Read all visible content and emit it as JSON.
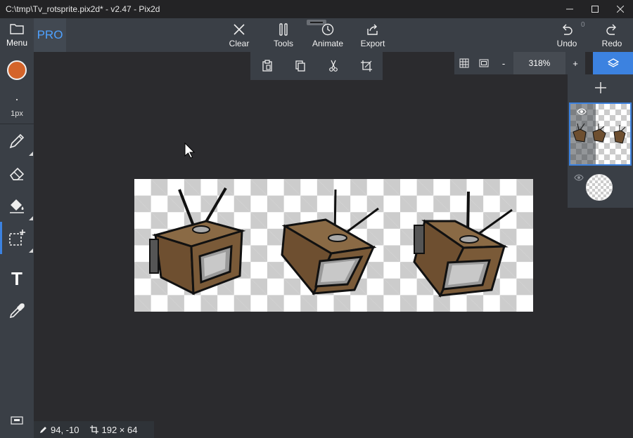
{
  "window": {
    "title": "C:\\tmp\\Tv_rotsprite.pix2d* - v2.47 - Pix2d"
  },
  "sidebar": {
    "menu_label": "Menu",
    "brush_size": "1px",
    "primary_color": "#d4642a"
  },
  "topbar": {
    "pro_label": "PRO",
    "clear_label": "Clear",
    "tools_label": "Tools",
    "animate_label": "Animate",
    "export_label": "Export",
    "undo_label": "Undo",
    "undo_count": "0",
    "redo_label": "Redo"
  },
  "zoom": {
    "minus": "-",
    "value": "318%",
    "plus": "+"
  },
  "text_tool_glyph": "T",
  "status": {
    "cursor_pos": "94, -10",
    "canvas_size": "192 × 64"
  },
  "colors": {
    "accent": "#3c82e0",
    "panel": "#3a3f46",
    "workspace": "#2b2b2e"
  }
}
